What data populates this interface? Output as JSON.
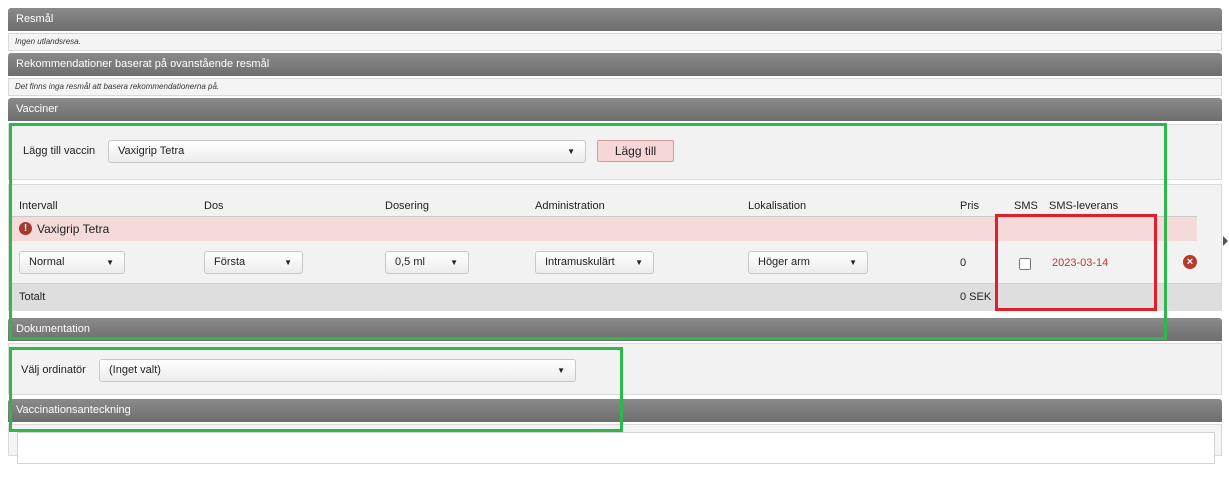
{
  "resmal": {
    "header": "Resmål",
    "note": "Ingen utlandsresa."
  },
  "rekommendationer": {
    "header": "Rekommendationer baserat på ovanstående resmål",
    "note": "Det finns inga resmål att basera rekommendationerna på."
  },
  "vacciner": {
    "header": "Vacciner",
    "add_label": "Lägg till vaccin",
    "add_select_value": "Vaxigrip Tetra",
    "add_button": "Lägg till",
    "columns": {
      "intervall": "Intervall",
      "dos": "Dos",
      "dosering": "Dosering",
      "administration": "Administration",
      "lokalisation": "Lokalisation",
      "pris": "Pris",
      "sms": "SMS",
      "sms_leverans": "SMS-leverans"
    },
    "row": {
      "name": "Vaxigrip Tetra",
      "intervall": "Normal",
      "dos": "Första",
      "dosering": "0,5 ml",
      "administration": "Intramuskulärt",
      "lokalisation": "Höger arm",
      "pris": "0",
      "sms_checked": false,
      "sms_leverans": "2023-03-14"
    },
    "total_label": "Totalt",
    "total_value": "0 SEK"
  },
  "dokumentation": {
    "header": "Dokumentation",
    "ordinator_label": "Välj ordinatör",
    "ordinator_value": "(Inget valt)"
  },
  "anteckning": {
    "header": "Vaccinationsanteckning"
  },
  "colors": {
    "header_bg": "#767676",
    "row_highlight": "#f5dada",
    "date_red": "#c0392b",
    "annotation_green": "#2fb84a",
    "annotation_red": "#e01f2a"
  }
}
